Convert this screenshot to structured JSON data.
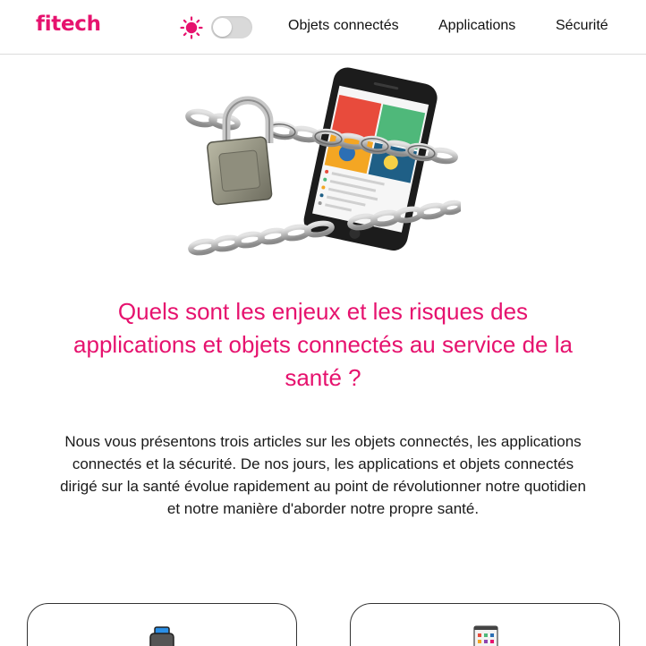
{
  "header": {
    "logo": "fitech",
    "theme_toggle_on": false,
    "nav": [
      {
        "label": "Objets connectés"
      },
      {
        "label": "Applications"
      },
      {
        "label": "Sécurité"
      }
    ]
  },
  "colors": {
    "brand": "#e6126e",
    "text": "#1a1a1a",
    "divider": "#dcdcdc",
    "toggle_track": "#d9d9d9"
  },
  "icons": {
    "theme": "sun-icon",
    "hero": "locked-phone-chains-illustration",
    "card_1": "smartwatch-icon",
    "card_2": "app-grid-icon"
  },
  "main": {
    "title": "Quels sont les enjeux et les risques des applications et objets connectés au service de la santé ?",
    "intro": "Nous vous présentons trois articles sur les objets connectés, les applications connectés et la sécurité. De nos jours, les applications et objets connectés dirigé sur la santé évolue rapidement au point de révolutionner notre quotidien et notre manière d'aborder notre propre santé."
  }
}
